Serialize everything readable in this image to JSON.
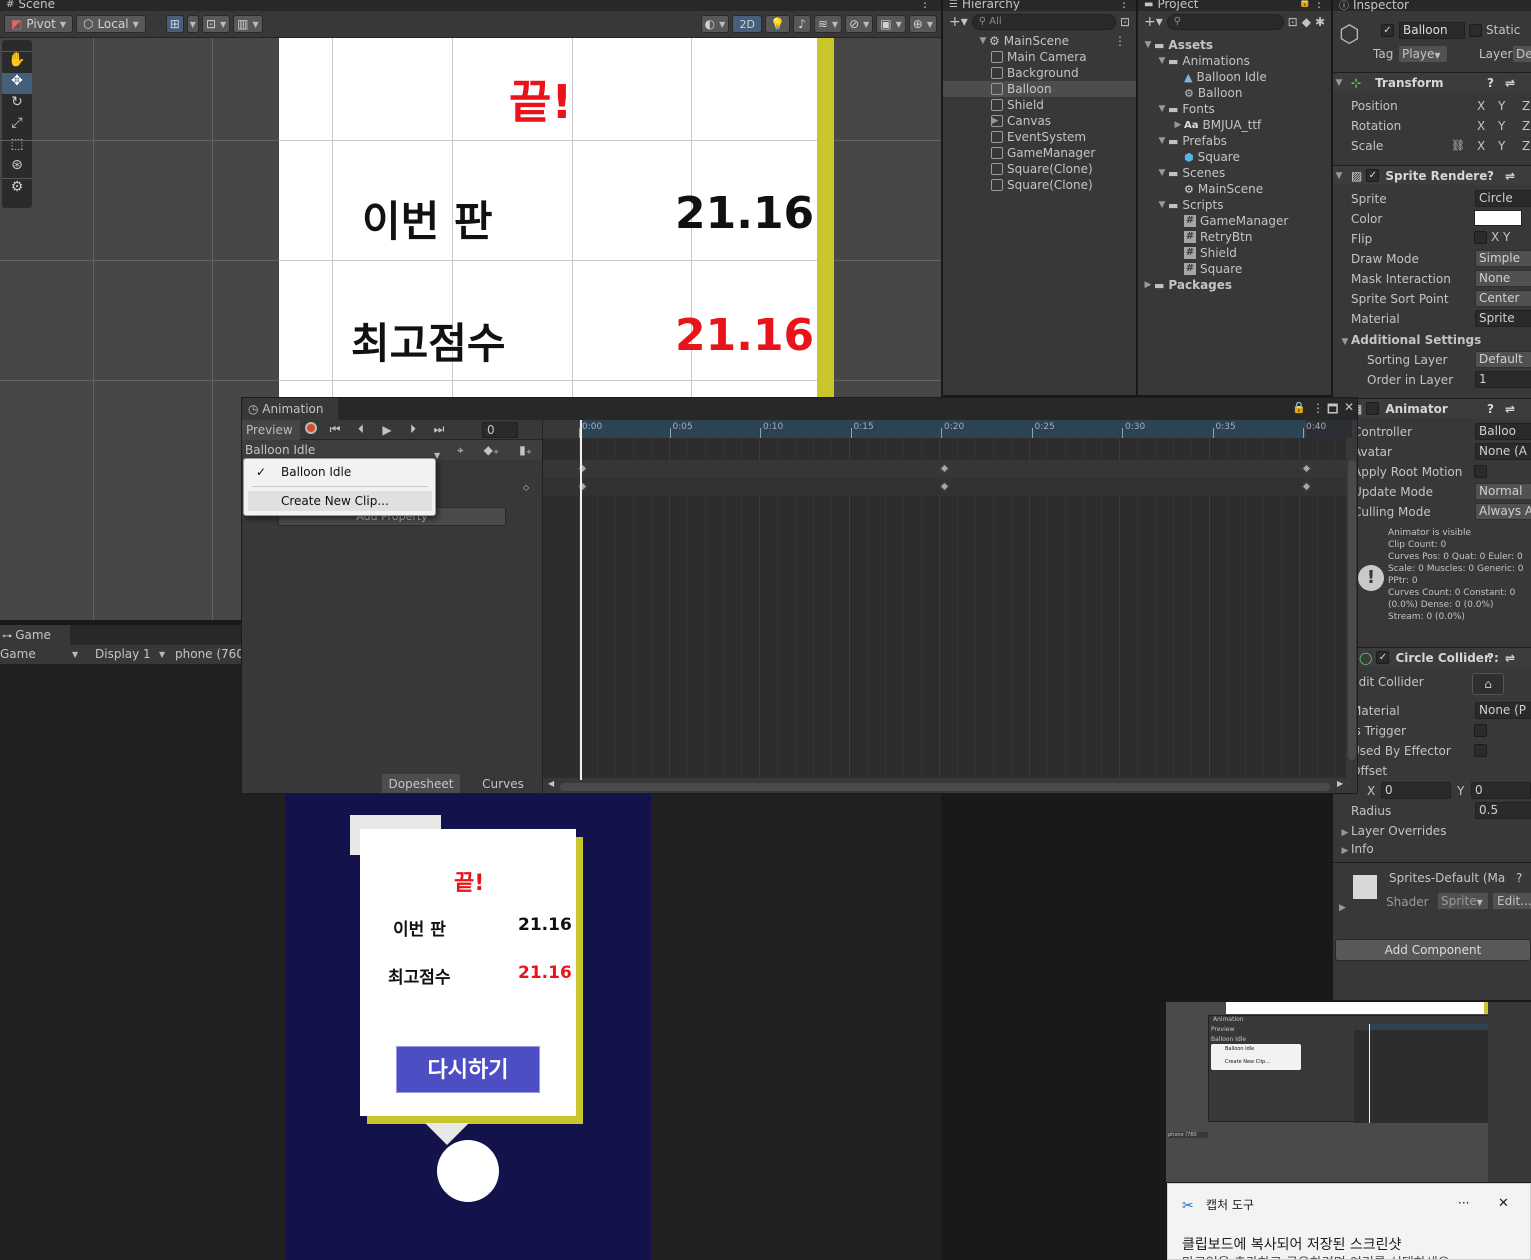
{
  "scene": {
    "tab": "Scene",
    "pivot": "Pivot",
    "local": "Local",
    "mode2d": "2D",
    "card": {
      "title": "끝!",
      "row1_label": "이번 판",
      "row1_value": "21.16",
      "row2_label": "최고점수",
      "row2_value": "21.16"
    }
  },
  "hierarchy": {
    "tab": "Hierarchy",
    "search": "All",
    "root": "MainScene",
    "items": [
      "Main Camera",
      "Background",
      "Balloon",
      "Shield",
      "Canvas",
      "EventSystem",
      "GameManager",
      "Square(Clone)",
      "Square(Clone)"
    ]
  },
  "project": {
    "tab": "Project",
    "items": [
      {
        "label": "Assets",
        "indent": 0,
        "type": "folder"
      },
      {
        "label": "Animations",
        "indent": 1,
        "type": "folder"
      },
      {
        "label": "Balloon Idle",
        "indent": 2,
        "type": "anim"
      },
      {
        "label": "Balloon",
        "indent": 2,
        "type": "ctrl"
      },
      {
        "label": "Fonts",
        "indent": 1,
        "type": "folder"
      },
      {
        "label": "BMJUA_ttf",
        "indent": 2,
        "type": "font"
      },
      {
        "label": "Prefabs",
        "indent": 1,
        "type": "folder"
      },
      {
        "label": "Square",
        "indent": 2,
        "type": "prefab"
      },
      {
        "label": "Scenes",
        "indent": 1,
        "type": "folder"
      },
      {
        "label": "MainScene",
        "indent": 2,
        "type": "scene"
      },
      {
        "label": "Scripts",
        "indent": 1,
        "type": "folder"
      },
      {
        "label": "GameManager",
        "indent": 2,
        "type": "script"
      },
      {
        "label": "RetryBtn",
        "indent": 2,
        "type": "script"
      },
      {
        "label": "Shield",
        "indent": 2,
        "type": "script"
      },
      {
        "label": "Square",
        "indent": 2,
        "type": "script"
      },
      {
        "label": "Packages",
        "indent": 0,
        "type": "folder"
      }
    ]
  },
  "inspector": {
    "tab": "Inspector",
    "object_name": "Balloon",
    "static": "Static",
    "tag_label": "Tag",
    "tag_value": "Playe",
    "layer_label": "Layer",
    "layer_value": "Def",
    "transform": {
      "title": "Transform",
      "position": "Position",
      "rotation": "Rotation",
      "scale": "Scale",
      "x": "X",
      "y": "Y",
      "z": "Z"
    },
    "sprite_renderer": {
      "title": "Sprite Rendere",
      "fields": [
        {
          "label": "Sprite",
          "value": "Circle"
        },
        {
          "label": "Color",
          "value": ""
        },
        {
          "label": "Flip",
          "value": "X  Y"
        },
        {
          "label": "Draw Mode",
          "value": "Simple"
        },
        {
          "label": "Mask Interaction",
          "value": "None"
        },
        {
          "label": "Sprite Sort Point",
          "value": "Center"
        },
        {
          "label": "Material",
          "value": "Sprite"
        }
      ],
      "additional": "Additional Settings",
      "sorting_layer": "Sorting Layer",
      "sorting_layer_value": "Default",
      "order_in_layer": "Order in Layer",
      "order_value": "1"
    },
    "animator": {
      "title": "Animator",
      "fields": [
        {
          "label": "Controller",
          "value": "Balloo"
        },
        {
          "label": "Avatar",
          "value": "None (A"
        },
        {
          "label": "Apply Root Motion",
          "value": ""
        },
        {
          "label": "Update Mode",
          "value": "Normal"
        },
        {
          "label": "Culling Mode",
          "value": "Always A"
        }
      ],
      "info": [
        "Animator is visible",
        "Clip Count: 0",
        "Curves Pos: 0 Quat: 0 Euler: 0",
        "Scale: 0 Muscles: 0 Generic: 0",
        "PPtr: 0",
        "Curves Count: 0 Constant: 0",
        "(0.0%) Dense: 0 (0.0%)",
        "Stream: 0 (0.0%)"
      ]
    },
    "circle_collider": {
      "title": "Circle Collider :",
      "edit": "Edit Collider",
      "material": "Material",
      "material_value": "None (P",
      "is_trigger": "Is Trigger",
      "used_by_effector": "Used By Effector",
      "offset": "Offset",
      "offset_x_label": "X",
      "offset_x": "0",
      "offset_y_label": "Y",
      "offset_y": "0",
      "radius": "Radius",
      "radius_value": "0.5",
      "layer_overrides": "Layer Overrides",
      "info": "Info"
    },
    "material_block": {
      "name": "Sprites-Default (Ma",
      "shader_label": "Shader",
      "shader_value": "Sprite",
      "edit": "Edit..."
    },
    "add_component": "Add Component"
  },
  "animation": {
    "tab": "Animation",
    "preview": "Preview",
    "frame": "0",
    "clip": "Balloon Idle",
    "add_property": "Add Property",
    "ticks": [
      "0:00",
      "0:05",
      "0:10",
      "0:15",
      "0:20",
      "0:25",
      "0:30",
      "0:35",
      "0:40"
    ],
    "dropdown": {
      "checked": "Balloon Idle",
      "create": "Create New Clip..."
    },
    "dopesheet": "Dopesheet",
    "curves": "Curves"
  },
  "game": {
    "tab": "Game",
    "mode": "Game",
    "display": "Display 1",
    "resolution": "phone (760x",
    "card": {
      "title": "끝!",
      "row1_label": "이번 판",
      "row1_value": "21.16",
      "row2_label": "최고점수",
      "row2_value": "21.16",
      "button": "다시하기"
    }
  },
  "toast": {
    "app": "캡처 도구",
    "more": "···",
    "line1": "클립보드에 복사되어 저장된 스크린샷",
    "line2": "마크업을 추가하고 공유하려면 여기를 선택하세요"
  },
  "thumb": {
    "tab": "Animation",
    "preview": "Preview",
    "clip": "Balloon Idle",
    "item1": "Balloon Idle",
    "item2": "Create New Clip...",
    "res": "phone (760"
  }
}
